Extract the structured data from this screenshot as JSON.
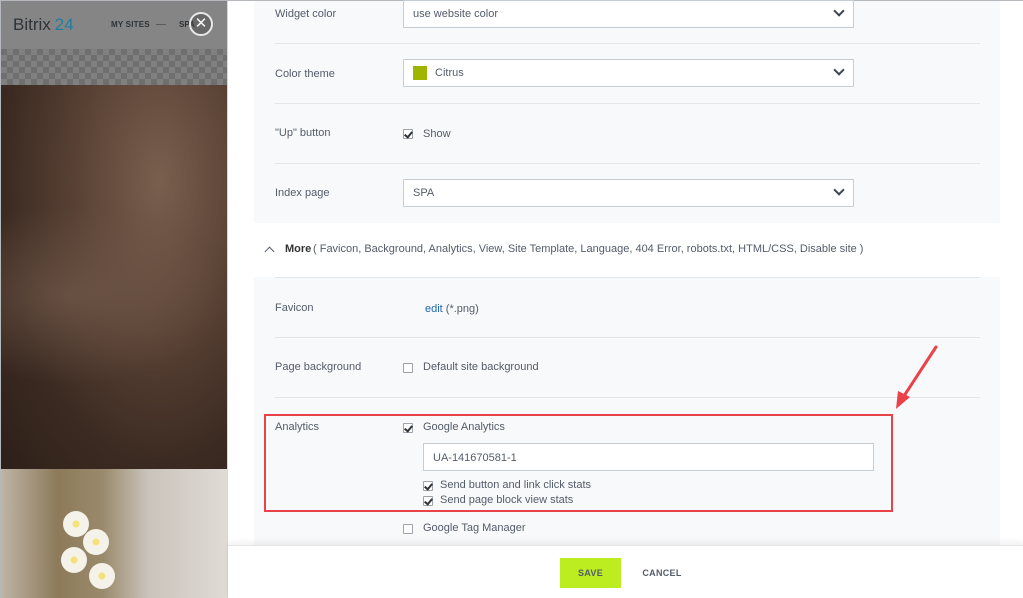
{
  "backdrop": {
    "logo_text": "Bitrix",
    "logo_num": "24",
    "nav_my_sites": "MY SITES",
    "nav_current": "SPA",
    "close_glyph": "✕"
  },
  "settings": {
    "widget_color": {
      "label": "Widget color",
      "value": "use website color"
    },
    "color_theme": {
      "label": "Color theme",
      "value": "Citrus",
      "swatch_color": "#9fb500"
    },
    "up_button": {
      "label": "\"Up\" button",
      "option": "Show",
      "checked": true
    },
    "index_page": {
      "label": "Index page",
      "value": "SPA"
    },
    "more": {
      "label": "More",
      "list": "( Favicon,  Background,  Analytics,  View,  Site Template,  Language,  404 Error,  robots.txt,  HTML/CSS,  Disable site )"
    },
    "favicon": {
      "label": "Favicon",
      "link": "edit",
      "hint": " (*.png)"
    },
    "page_background": {
      "label": "Page background",
      "option": "Default site background",
      "checked": false
    },
    "analytics": {
      "label": "Analytics",
      "google_analytics": "Google Analytics",
      "ga_id": "UA-141670581-1",
      "send_clicks": "Send button and link click stats",
      "send_views": "Send page block view stats",
      "google_tag_manager": "Google Tag Manager"
    }
  },
  "footer": {
    "save": "SAVE",
    "cancel": "CANCEL"
  },
  "colors": {
    "accent_save": "#bbed21",
    "highlight": "#e94249",
    "link": "#2067b0"
  }
}
